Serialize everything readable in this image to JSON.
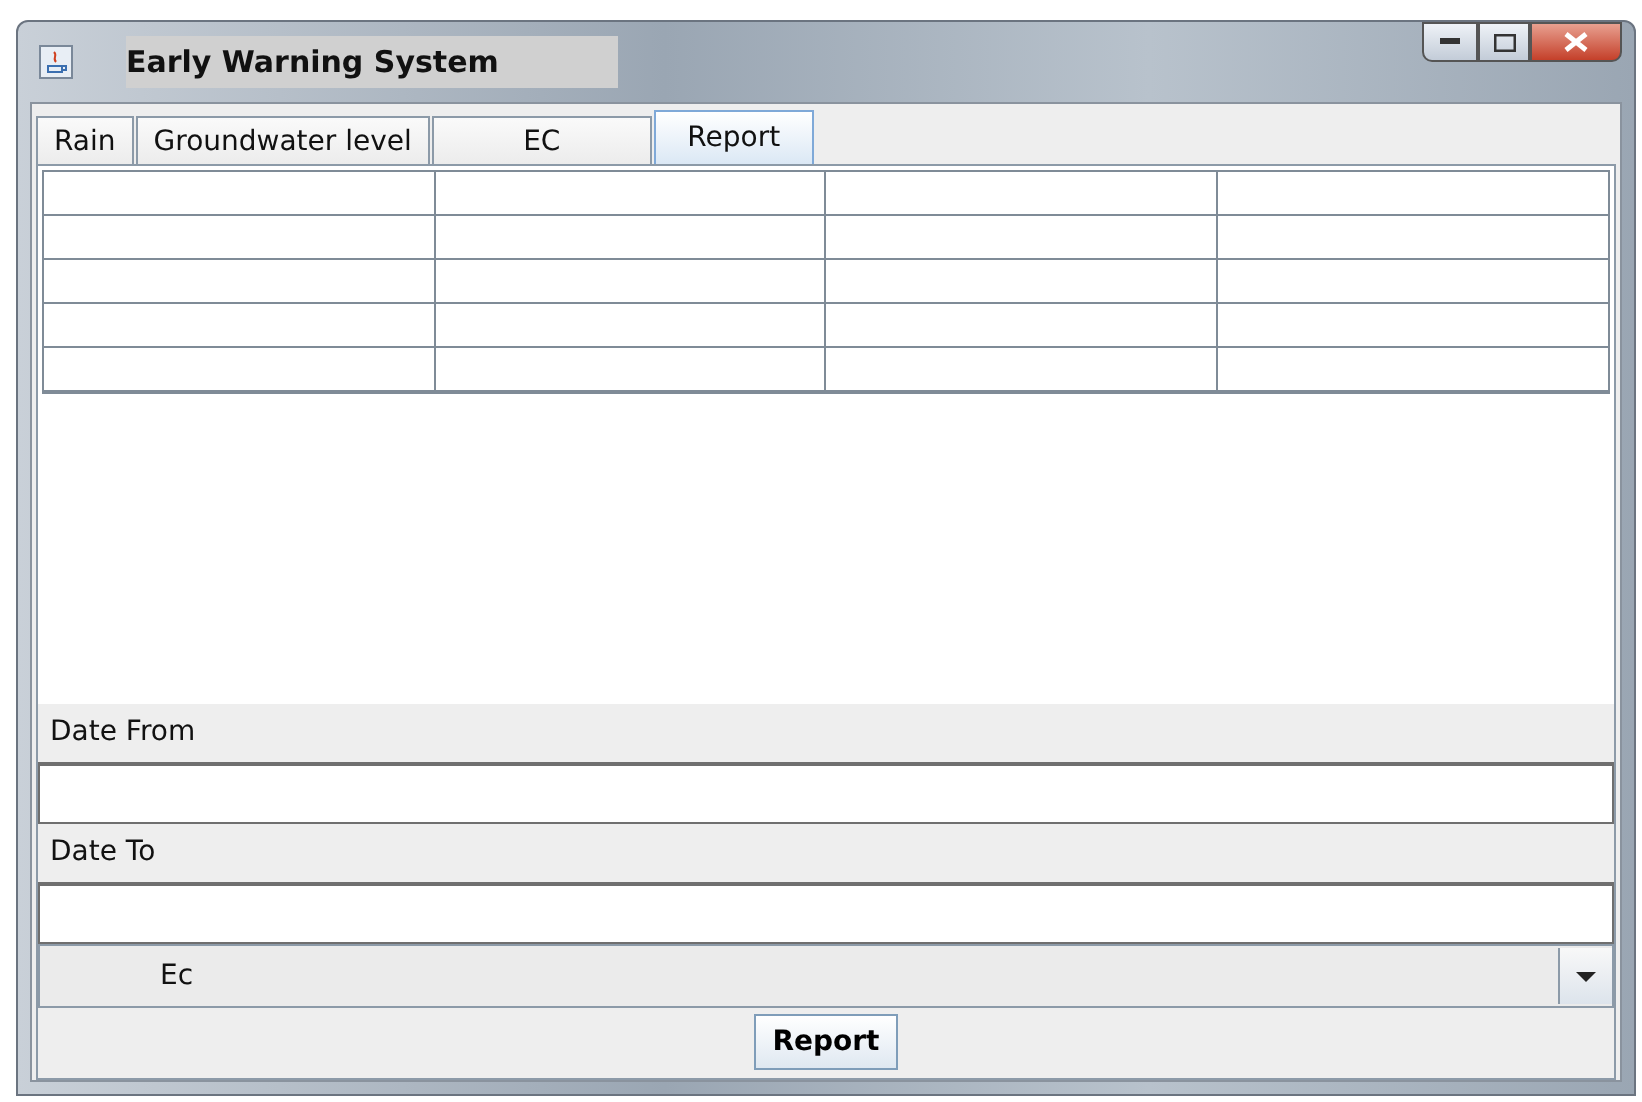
{
  "window": {
    "title": "Early Warning System"
  },
  "tabs": [
    {
      "label": "Rain",
      "selected": false
    },
    {
      "label": "Groundwater level",
      "selected": false
    },
    {
      "label": "EC",
      "selected": false
    },
    {
      "label": "Report",
      "selected": true
    }
  ],
  "form": {
    "date_from": {
      "label": "Date From"
    },
    "date_to": {
      "label": "Date To"
    },
    "parameter": {
      "value": "Ec"
    },
    "button": "Report"
  }
}
